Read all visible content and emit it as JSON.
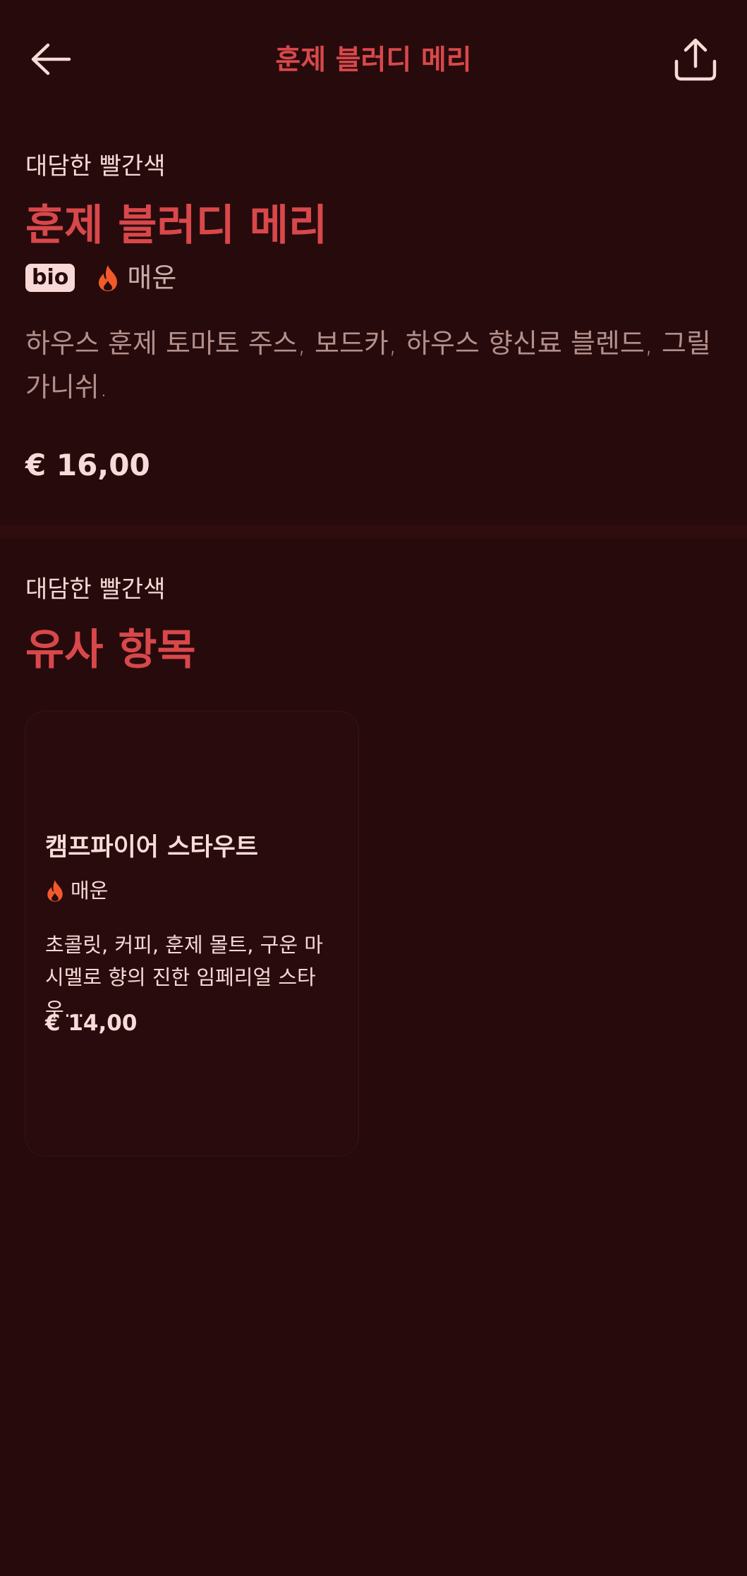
{
  "header": {
    "title": "훈제 블러디 메리",
    "back_icon": "arrow-left-icon",
    "share_icon": "share-icon"
  },
  "item": {
    "category": "대담한 빨간색",
    "title": "훈제 블러디 메리",
    "badge": "bio",
    "spicy_icon": "flame-icon",
    "spicy_label": "매운",
    "description": "하우스 훈제 토마토 주스, 보드카, 하우스 향신료 블렌드, 그릴 가니쉬.",
    "price": "€ 16,00"
  },
  "similar": {
    "category": "대담한 빨간색",
    "title": "유사 항목",
    "cards": [
      {
        "title": "캠프파이어 스타우트",
        "spicy_label": "매운",
        "description": "초콜릿, 커피, 훈제 몰트, 구운 마시멜로 향의 진한 임페리얼 스타우…",
        "price": "€ 14,00"
      }
    ]
  },
  "colors": {
    "background": "#270a0c",
    "accent": "#d8484b",
    "text": "#f6dcd8",
    "flame": "#f25a2a"
  }
}
